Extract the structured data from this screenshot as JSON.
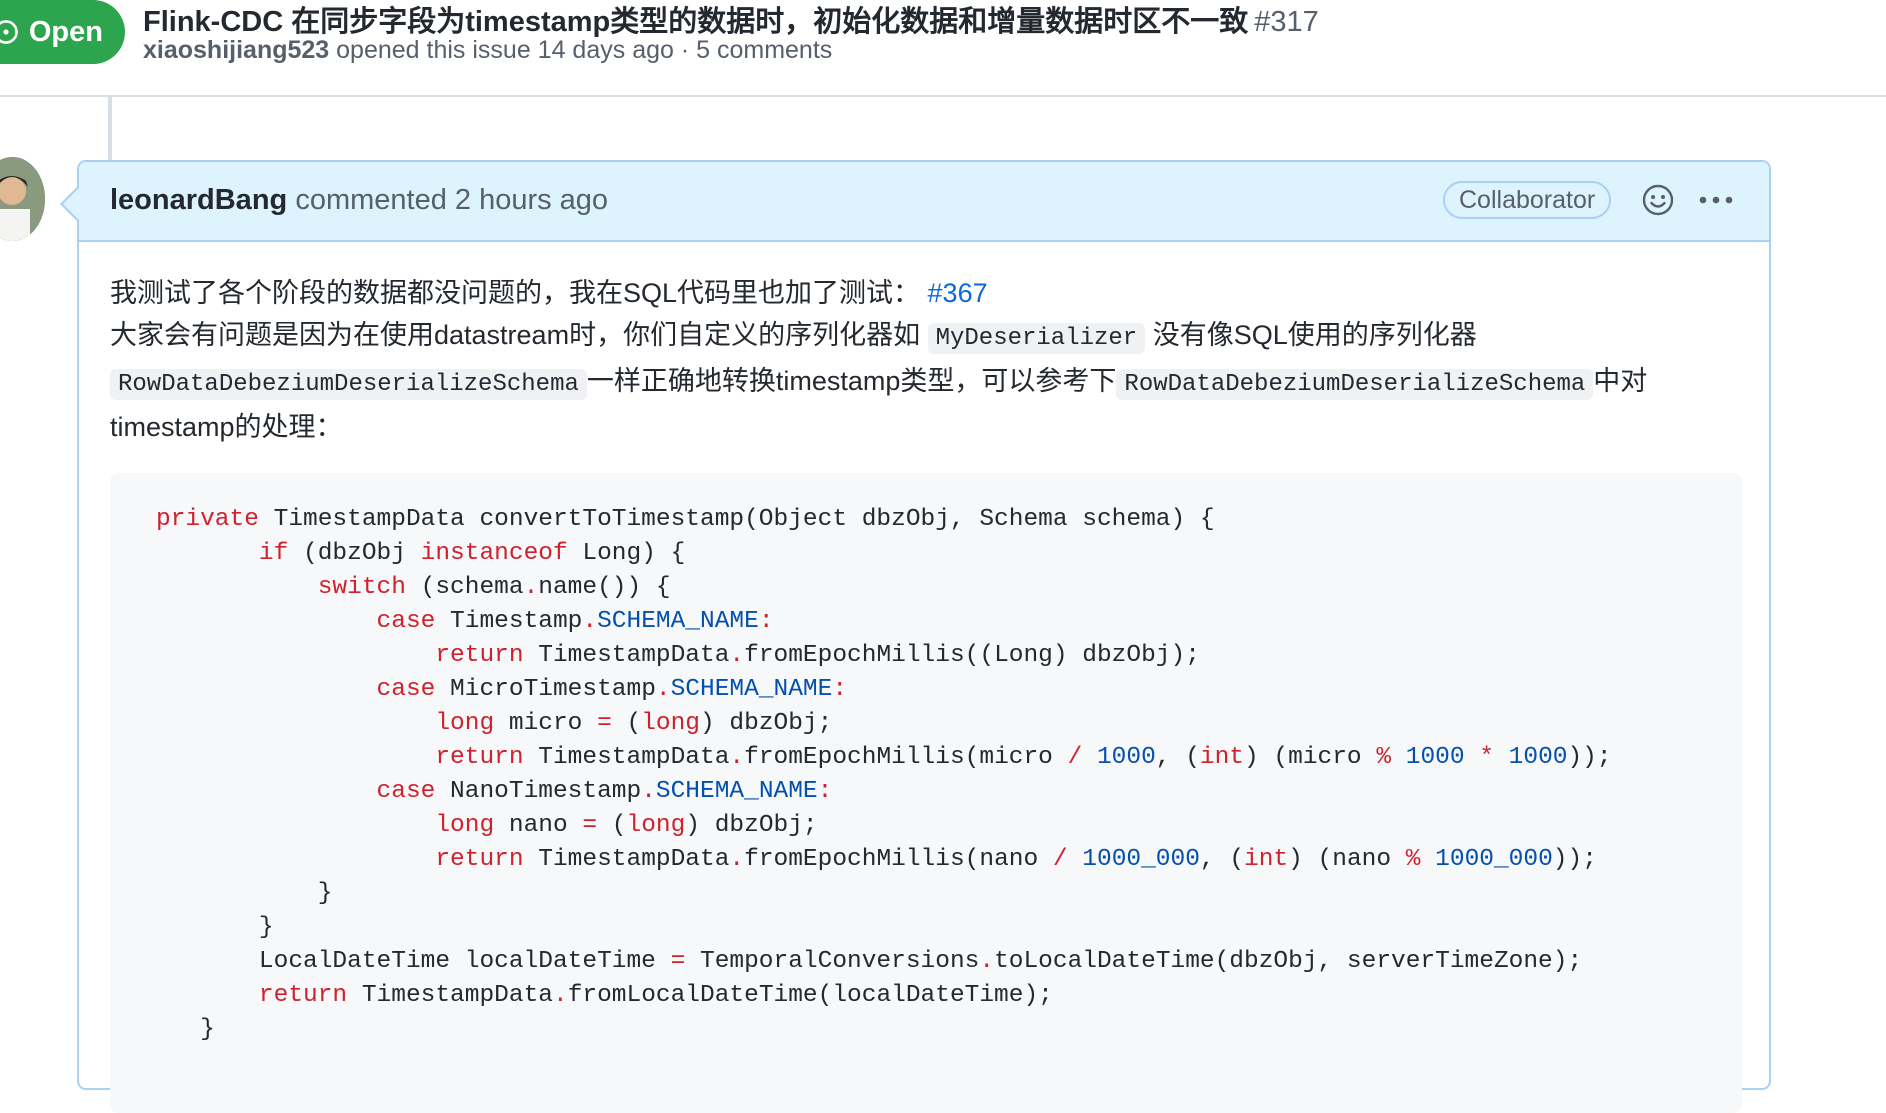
{
  "issue": {
    "state": "Open",
    "title": "Flink-CDC 在同步字段为timestamp类型的数据时，初始化数据和增量数据时区不一致",
    "number": "#317",
    "author": "xiaoshijiang523",
    "meta": "opened this issue 14 days ago · 5 comments"
  },
  "comment": {
    "author": "leonardBang",
    "meta": "commented 2 hours ago",
    "role": "Collaborator",
    "body": {
      "line1_text": "我测试了各个阶段的数据都没问题的，我在SQL代码里也加了测试： ",
      "line1_link": "#367",
      "line2_text_a": "大家会有问题是因为在使用datastream时，你们自定义的序列化器如 ",
      "line2_code": "MyDeserializer",
      "line2_text_b": " 没有像SQL使用的序列化器",
      "line3_code_a": "RowDataDebeziumDeserializeSchema",
      "line3_text": "一样正确地转换timestamp类型，可以参考下",
      "line3_code_b": "RowDataDebeziumDeserializeSchema",
      "line3_text_end": "中对",
      "line4_text": "timestamp的处理："
    }
  },
  "code": {
    "lines": [
      [
        [
          "kw",
          "private"
        ],
        [
          "t",
          " TimestampData convertToTimestamp(Object dbzObj, Schema schema) {"
        ]
      ],
      [
        [
          "t",
          "       "
        ],
        [
          "kw",
          "if"
        ],
        [
          "t",
          " (dbzObj "
        ],
        [
          "kw",
          "instanceof"
        ],
        [
          "t",
          " Long) {"
        ]
      ],
      [
        [
          "t",
          "           "
        ],
        [
          "kw",
          "switch"
        ],
        [
          "t",
          " (schema"
        ],
        [
          "op",
          "."
        ],
        [
          "t",
          "name()) {"
        ]
      ],
      [
        [
          "t",
          "               "
        ],
        [
          "kw",
          "case"
        ],
        [
          "t",
          " Timestamp"
        ],
        [
          "op",
          "."
        ],
        [
          "cst",
          "SCHEMA_NAME"
        ],
        [
          "op",
          ":"
        ]
      ],
      [
        [
          "t",
          "                   "
        ],
        [
          "kw",
          "return"
        ],
        [
          "t",
          " TimestampData"
        ],
        [
          "op",
          "."
        ],
        [
          "t",
          "fromEpochMillis((Long) dbzObj);"
        ]
      ],
      [
        [
          "t",
          "               "
        ],
        [
          "kw",
          "case"
        ],
        [
          "t",
          " MicroTimestamp"
        ],
        [
          "op",
          "."
        ],
        [
          "cst",
          "SCHEMA_NAME"
        ],
        [
          "op",
          ":"
        ]
      ],
      [
        [
          "t",
          "                   "
        ],
        [
          "kw",
          "long"
        ],
        [
          "t",
          " micro "
        ],
        [
          "op",
          "="
        ],
        [
          "t",
          " ("
        ],
        [
          "kw",
          "long"
        ],
        [
          "t",
          ") dbzObj;"
        ]
      ],
      [
        [
          "t",
          "                   "
        ],
        [
          "kw",
          "return"
        ],
        [
          "t",
          " TimestampData"
        ],
        [
          "op",
          "."
        ],
        [
          "t",
          "fromEpochMillis(micro "
        ],
        [
          "op",
          "/"
        ],
        [
          "t",
          " "
        ],
        [
          "cst",
          "1000"
        ],
        [
          "t",
          ", ("
        ],
        [
          "kw",
          "int"
        ],
        [
          "t",
          ") (micro "
        ],
        [
          "op",
          "%"
        ],
        [
          "t",
          " "
        ],
        [
          "cst",
          "1000"
        ],
        [
          "t",
          " "
        ],
        [
          "op",
          "*"
        ],
        [
          "t",
          " "
        ],
        [
          "cst",
          "1000"
        ],
        [
          "t",
          "));"
        ]
      ],
      [
        [
          "t",
          "               "
        ],
        [
          "kw",
          "case"
        ],
        [
          "t",
          " NanoTimestamp"
        ],
        [
          "op",
          "."
        ],
        [
          "cst",
          "SCHEMA_NAME"
        ],
        [
          "op",
          ":"
        ]
      ],
      [
        [
          "t",
          "                   "
        ],
        [
          "kw",
          "long"
        ],
        [
          "t",
          " nano "
        ],
        [
          "op",
          "="
        ],
        [
          "t",
          " ("
        ],
        [
          "kw",
          "long"
        ],
        [
          "t",
          ") dbzObj;"
        ]
      ],
      [
        [
          "t",
          "                   "
        ],
        [
          "kw",
          "return"
        ],
        [
          "t",
          " TimestampData"
        ],
        [
          "op",
          "."
        ],
        [
          "t",
          "fromEpochMillis(nano "
        ],
        [
          "op",
          "/"
        ],
        [
          "t",
          " "
        ],
        [
          "cst",
          "1000_000"
        ],
        [
          "t",
          ", ("
        ],
        [
          "kw",
          "int"
        ],
        [
          "t",
          ") (nano "
        ],
        [
          "op",
          "%"
        ],
        [
          "t",
          " "
        ],
        [
          "cst",
          "1000_000"
        ],
        [
          "t",
          "));"
        ]
      ],
      [
        [
          "t",
          "           }"
        ]
      ],
      [
        [
          "t",
          "       }"
        ]
      ],
      [
        [
          "t",
          "       LocalDateTime localDateTime "
        ],
        [
          "op",
          "="
        ],
        [
          "t",
          " TemporalConversions"
        ],
        [
          "op",
          "."
        ],
        [
          "t",
          "toLocalDateTime(dbzObj, serverTimeZone);"
        ]
      ],
      [
        [
          "t",
          "       "
        ],
        [
          "kw",
          "return"
        ],
        [
          "t",
          " TimestampData"
        ],
        [
          "op",
          "."
        ],
        [
          "t",
          "fromLocalDateTime(localDateTime);"
        ]
      ],
      [
        [
          "t",
          "   }"
        ]
      ]
    ]
  },
  "colors": {
    "open_badge": "#2da44e",
    "comment_header_bg": "#ddf4ff",
    "comment_border": "#a8d1f2",
    "link": "#0969da",
    "keyword": "#cf222e",
    "constant": "#0550ae"
  },
  "icons": {
    "state": "issue-opened-icon",
    "reaction": "smiley-icon",
    "menu": "kebab-horizontal-icon"
  }
}
